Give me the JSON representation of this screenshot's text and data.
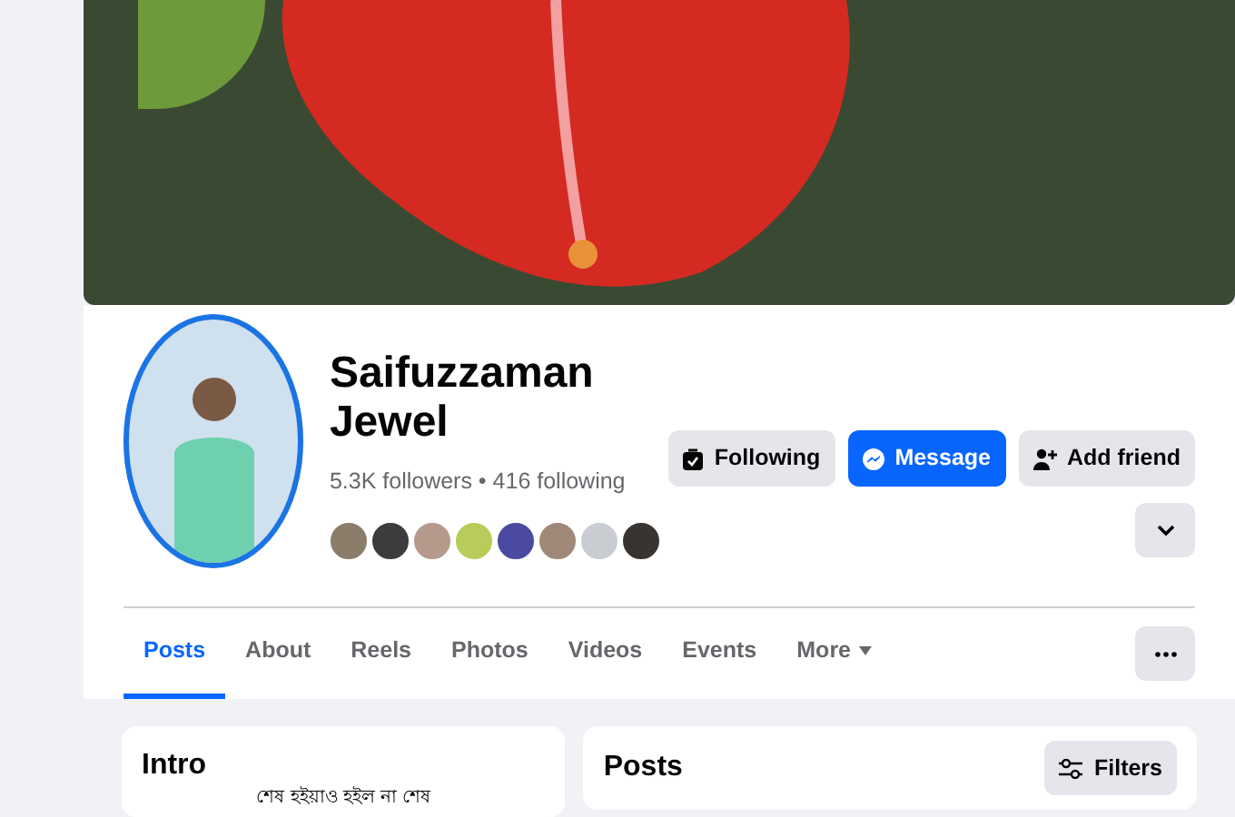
{
  "profile": {
    "name": "Saifuzzaman Jewel",
    "stats": "5.3K followers • 416 following"
  },
  "actions": [
    {
      "kind": "following",
      "label": "Following"
    },
    {
      "kind": "message",
      "label": "Message"
    },
    {
      "kind": "add_friend",
      "label": "Add friend"
    }
  ],
  "tabs": [
    {
      "label": "Posts",
      "selected": true,
      "dropdown": false
    },
    {
      "label": "About",
      "selected": false,
      "dropdown": false
    },
    {
      "label": "Reels",
      "selected": false,
      "dropdown": false
    },
    {
      "label": "Photos",
      "selected": false,
      "dropdown": false
    },
    {
      "label": "Videos",
      "selected": false,
      "dropdown": false
    },
    {
      "label": "Events",
      "selected": false,
      "dropdown": false
    },
    {
      "label": "More",
      "selected": false,
      "dropdown": true
    }
  ],
  "intro": {
    "title": "Intro",
    "bio": "শেষ হইয়াও হইল না শেষ"
  },
  "posts": {
    "title": "Posts",
    "filter_label": "Filters"
  }
}
